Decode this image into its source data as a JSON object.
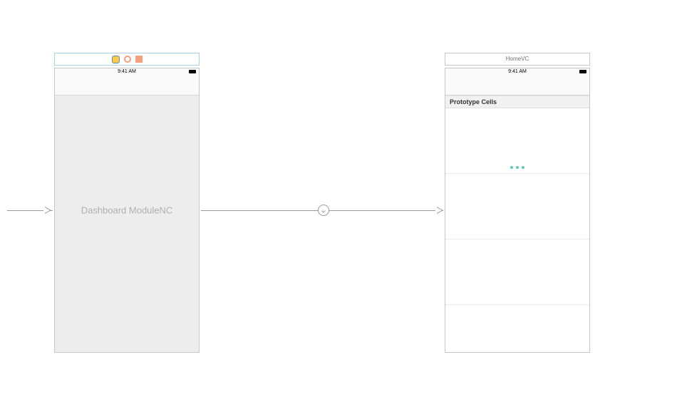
{
  "scene1": {
    "statusTime": "9:41 AM",
    "placeholderText": "Dashboard ModuleNC"
  },
  "scene2": {
    "title": "HomeVC",
    "statusTime": "9:41 AM",
    "sectionHeader": "Prototype Cells"
  }
}
